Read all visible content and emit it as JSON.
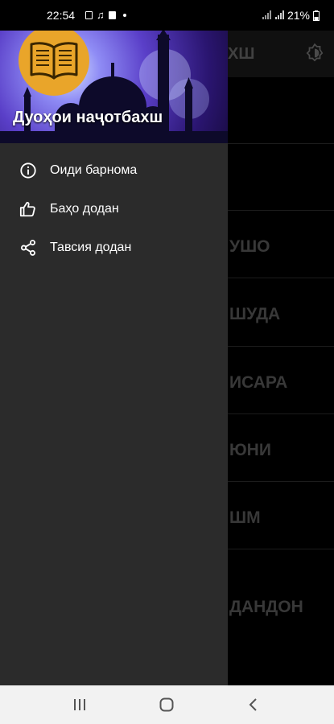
{
  "status_bar": {
    "time": "22:54",
    "battery": "21%"
  },
  "background_app": {
    "title_fragment": "ХШ",
    "rows": [
      "",
      "",
      "УШО",
      "ШУДА",
      "ИСАРА",
      "ЮНИ",
      "ШМ",
      "ДАНДОН"
    ]
  },
  "drawer": {
    "title": "Дуоҳои наҷотбахш",
    "items": [
      {
        "label": "Оиди барнома",
        "icon": "info-icon"
      },
      {
        "label": "Баҳо додан",
        "icon": "thumbs-up-icon"
      },
      {
        "label": "Тавсия додан",
        "icon": "share-icon"
      }
    ]
  },
  "colors": {
    "drawer_bg": "#2b2b2b",
    "logo_bg": "#e9a52a",
    "scrim": "rgba(0,0,0,0.45)"
  }
}
